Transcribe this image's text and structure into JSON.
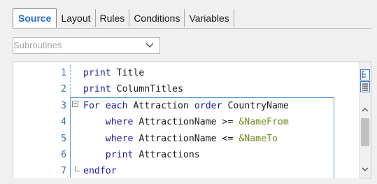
{
  "tabs": [
    {
      "label": "Source",
      "active": true
    },
    {
      "label": "Layout",
      "active": false
    },
    {
      "label": "Rules",
      "active": false
    },
    {
      "label": "Conditions",
      "active": false
    },
    {
      "label": "Variables",
      "active": false
    }
  ],
  "dropdown": {
    "placeholder": "Subroutines"
  },
  "editor": {
    "lines": [
      {
        "num": "1",
        "tokens": [
          {
            "t": "print",
            "c": "kw"
          },
          {
            "t": " Title",
            "c": "id"
          }
        ]
      },
      {
        "num": "2",
        "tokens": [
          {
            "t": "print",
            "c": "kw"
          },
          {
            "t": " ColumnTitles",
            "c": "id"
          }
        ]
      },
      {
        "num": "3",
        "tokens": [
          {
            "t": "For each",
            "c": "kw"
          },
          {
            "t": " Attraction ",
            "c": "id"
          },
          {
            "t": "order",
            "c": "kw"
          },
          {
            "t": " CountryName",
            "c": "id"
          }
        ]
      },
      {
        "num": "4",
        "tokens": [
          {
            "t": "    where",
            "c": "kw"
          },
          {
            "t": " AttractionName >= ",
            "c": "id"
          },
          {
            "t": "&NameFrom",
            "c": "var"
          }
        ]
      },
      {
        "num": "5",
        "tokens": [
          {
            "t": "    where",
            "c": "kw"
          },
          {
            "t": " AttractionName <= ",
            "c": "id"
          },
          {
            "t": "&NameTo",
            "c": "var"
          }
        ]
      },
      {
        "num": "6",
        "tokens": [
          {
            "t": "    print",
            "c": "kw"
          },
          {
            "t": " Attractions",
            "c": "id"
          }
        ]
      },
      {
        "num": "7",
        "tokens": [
          {
            "t": "endfor",
            "c": "kw"
          }
        ]
      }
    ]
  },
  "icons": {
    "dropdown_chevron": "chevron-down-icon",
    "scroll_up": "scroll-up-arrow-icon",
    "scroll_down": "scroll-down-arrow-icon",
    "outline_tool": "tree-outline-icon",
    "format_tool": "align-text-icon"
  },
  "colors": {
    "active_tab": "#1f6fc5",
    "keyword": "#1a1aa8",
    "variable": "#6b8e23",
    "line_number": "#2a6fb8",
    "block_frame": "#5b9bd5"
  }
}
